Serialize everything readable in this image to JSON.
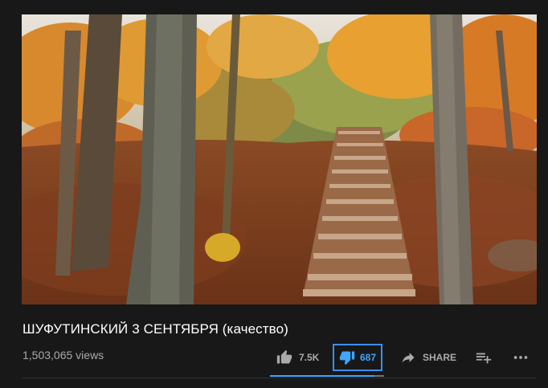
{
  "video": {
    "title": "ШУФУТИНСКИЙ 3 СЕНТЯБРЯ (качество)",
    "views": "1,503,065 views",
    "thumbnail_description_icon": "video-frame"
  },
  "actions": {
    "like_count": "7.5K",
    "dislike_count": "687",
    "share_label": "SHARE",
    "like_icon": "thumb-up-icon",
    "dislike_icon": "thumb-down-icon",
    "share_icon": "share-arrow-icon",
    "save_icon": "playlist-add-icon",
    "more_icon": "more-horizontal-icon"
  },
  "sentiment": {
    "like_fraction": 0.916
  },
  "colors": {
    "background": "#181818",
    "accent": "#3ea6ff",
    "focus_outline": "#3d8ef8",
    "secondary_text": "#aaaaaa"
  }
}
